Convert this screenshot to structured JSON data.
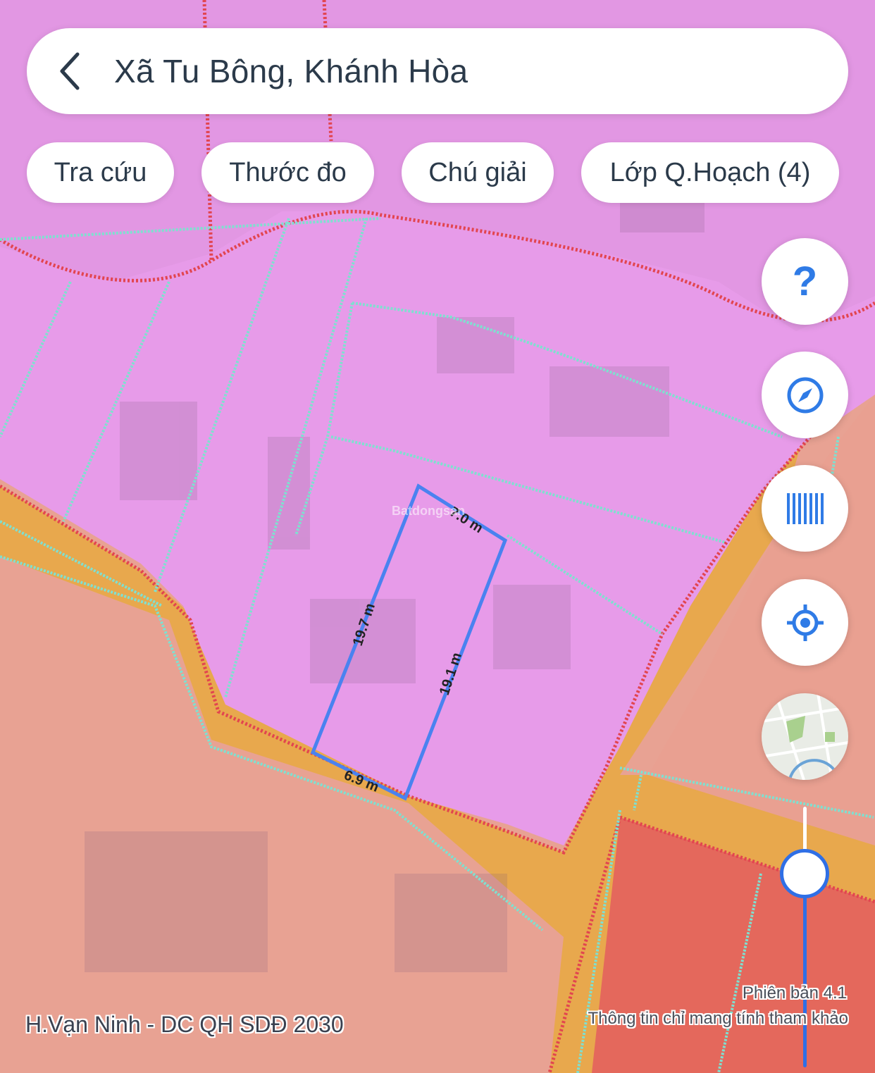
{
  "search": {
    "text": "Xã Tu Bông, Khánh Hòa"
  },
  "chips": [
    {
      "label": "Tra cứu"
    },
    {
      "label": "Thước đo"
    },
    {
      "label": "Chú giải"
    },
    {
      "label": "Lớp Q.Hoạch (4)"
    }
  ],
  "fabs": {
    "help_label": "?",
    "icons": [
      "help-icon",
      "compass-icon",
      "barcode-icon",
      "locate-icon",
      "minimap-icon"
    ]
  },
  "measurements": {
    "top": "7.0 m",
    "left": "19.7 m",
    "right": "19.1 m",
    "bottom": "6.9 m"
  },
  "footer": {
    "layer_name": "H.Vạn Ninh - DC QH SDĐ 2030",
    "version": "Phiên bản 4.1",
    "disclaimer": "Thông tin chỉ mang tính tham khảo"
  },
  "watermark": "Batdongsan",
  "colors": {
    "residential": "#e69be8",
    "road": "#e8a94e",
    "agricultural": "#e99f8d",
    "commercial": "#e4675a",
    "parcel_line": "#7fe0d0",
    "measure_line": "#4a82f0",
    "accent": "#2f7be6"
  }
}
